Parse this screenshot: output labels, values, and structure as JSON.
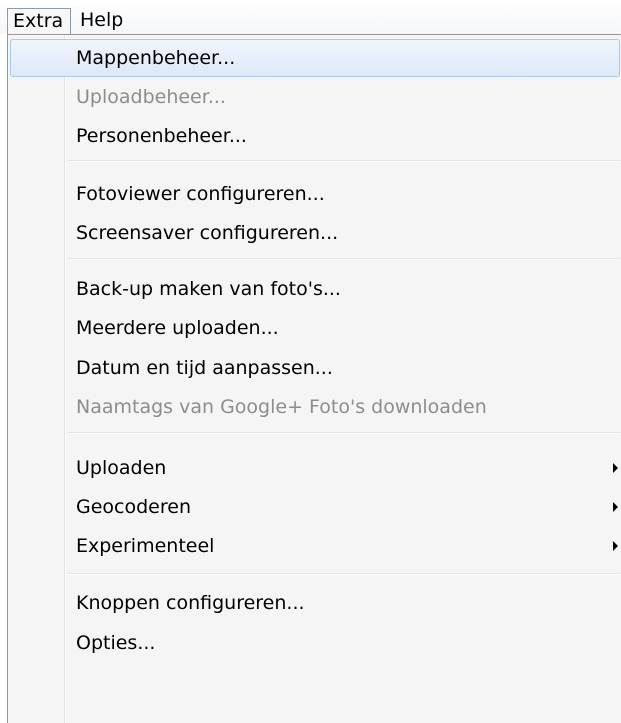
{
  "menubar": {
    "items": [
      {
        "label": "Extra"
      },
      {
        "label": "Help"
      }
    ]
  },
  "menu": {
    "groups": [
      [
        {
          "label": "Mappenbeheer...",
          "enabled": true,
          "highlighted": true
        },
        {
          "label": "Uploadbeheer...",
          "enabled": false
        },
        {
          "label": "Personenbeheer...",
          "enabled": true
        }
      ],
      [
        {
          "label": "Fotoviewer configureren...",
          "enabled": true
        },
        {
          "label": "Screensaver configureren...",
          "enabled": true
        }
      ],
      [
        {
          "label": "Back-up maken van foto's...",
          "enabled": true
        },
        {
          "label": "Meerdere uploaden...",
          "enabled": true
        },
        {
          "label": "Datum en tijd aanpassen...",
          "enabled": true
        },
        {
          "label": "Naamtags van Google+ Foto's downloaden",
          "enabled": false
        }
      ],
      [
        {
          "label": "Uploaden",
          "enabled": true,
          "submenu": true
        },
        {
          "label": "Geocoderen",
          "enabled": true,
          "submenu": true
        },
        {
          "label": "Experimenteel",
          "enabled": true,
          "submenu": true
        }
      ],
      [
        {
          "label": "Knoppen configureren...",
          "enabled": true
        },
        {
          "label": "Opties...",
          "enabled": true
        }
      ]
    ]
  },
  "colors": {
    "highlight_border": "#a8c8ec",
    "disabled_text": "#8d8d8d",
    "menu_background": "#f5f5f5"
  }
}
